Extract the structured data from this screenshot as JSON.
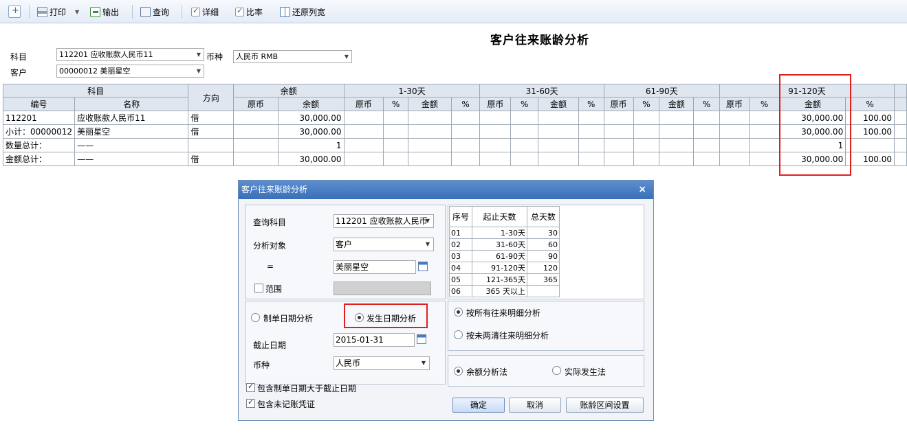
{
  "toolbar": {
    "print_label": "打印",
    "export_label": "输出",
    "query_label": "查询",
    "detail_label": "详细",
    "ratio_label": "比率",
    "restore_cols_label": "还原列宽"
  },
  "report": {
    "title": "客户往来账龄分析",
    "account_label": "科目",
    "account_value": "112201 应收账款人民币11",
    "currency_label": "币种",
    "currency_value": "人民币 RMB",
    "customer_label": "客户",
    "customer_value": "00000012   美丽星空"
  },
  "grid": {
    "group_headers": {
      "subject": "科目",
      "direction": "方向",
      "balance": "余额",
      "d1_30": "1-30天",
      "d31_60": "31-60天",
      "d61_90": "61-90天",
      "d91_120": "91-120天"
    },
    "sub_headers": {
      "code": "编号",
      "name": "名称",
      "orig": "原币",
      "balance": "余额",
      "pct": "%",
      "amount": "金额"
    },
    "rows": [
      {
        "code": "112201",
        "name": "应收账款人民币11",
        "dir": "借",
        "balance": "30,000.00",
        "amount_91_120": "30,000.00",
        "pct_91_120": "100.00"
      },
      {
        "code": "小计：00000012",
        "name": "美丽星空",
        "dir": "借",
        "balance": "30,000.00",
        "amount_91_120": "30,000.00",
        "pct_91_120": "100.00"
      },
      {
        "code": "数量总计：",
        "name": "——",
        "dir": "",
        "balance": "1",
        "amount_91_120": "1",
        "pct_91_120": ""
      },
      {
        "code": "金额总计：",
        "name": "——",
        "dir": "借",
        "balance": "30,000.00",
        "amount_91_120": "30,000.00",
        "pct_91_120": "100.00"
      }
    ]
  },
  "dialog": {
    "title": "客户往来账龄分析",
    "query_subject_label": "查询科目",
    "query_subject_value": "112201 应收账款人民币",
    "analysis_object_label": "分析对象",
    "analysis_object_value": "客户",
    "equals_label": "=",
    "object_value": "美丽星空",
    "range_label": "范围",
    "voucher_date_label": "制单日期分析",
    "occur_date_label": "发生日期分析",
    "cutoff_date_label": "截止日期",
    "cutoff_date_value": "2015-01-31",
    "currency_label": "币种",
    "currency_value": "人民币",
    "include_after_cutoff_label": "包含制单日期大于截止日期",
    "include_unposted_label": "包含未记账凭证",
    "all_detail_label": "按所有往来明细分析",
    "uncleared_label": "按未两清往来明细分析",
    "balance_method_label": "余额分析法",
    "actual_method_label": "实际发生法",
    "ok_label": "确定",
    "cancel_label": "取消",
    "interval_settings_label": "账龄区间设置",
    "intervals": {
      "headers": [
        "序号",
        "起止天数",
        "总天数"
      ],
      "rows": [
        [
          "01",
          "1-30天",
          "30"
        ],
        [
          "02",
          "31-60天",
          "60"
        ],
        [
          "03",
          "61-90天",
          "90"
        ],
        [
          "04",
          "91-120天",
          "120"
        ],
        [
          "05",
          "121-365天",
          "365"
        ],
        [
          "06",
          "365 天以上",
          ""
        ]
      ]
    }
  },
  "colors": {
    "highlight": "#e0201e",
    "dialog_title": "#3a6fb8",
    "grid_header": "#dfe6f0"
  }
}
